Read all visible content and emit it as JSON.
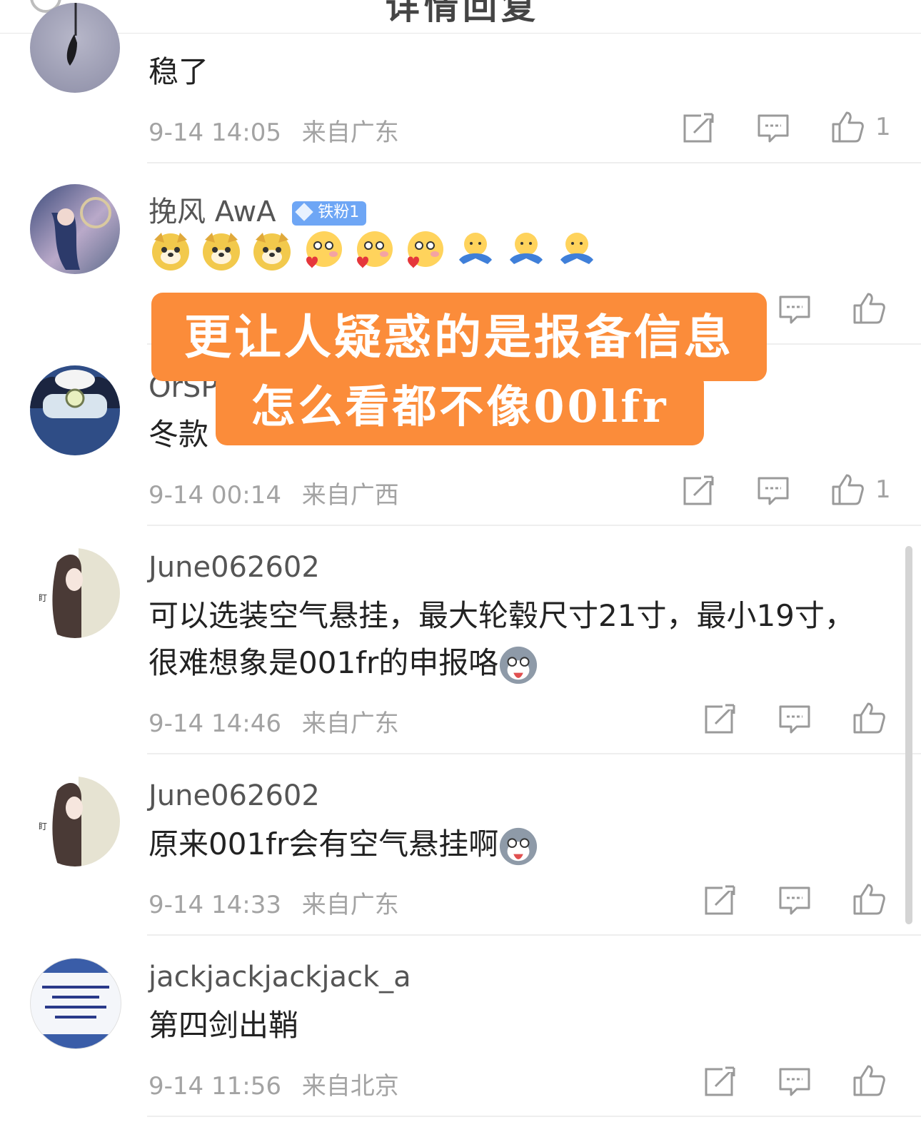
{
  "header": {
    "title": "详情回复",
    "more_icon": "more-icon"
  },
  "comments": [
    {
      "name": "",
      "text": "稳了",
      "date": "9-14 14:05",
      "location": "来自广东",
      "likes": "1"
    },
    {
      "name": "挽风 AwA",
      "badge": "铁粉1",
      "emojis": [
        "doge",
        "doge",
        "doge",
        "blush-heart",
        "blush-heart",
        "blush-heart",
        "hug",
        "hug",
        "hug"
      ]
    },
    {
      "name": "OrSP",
      "text": "冬款",
      "date": "9-14 00:14",
      "location": "来自广西",
      "likes": "1"
    },
    {
      "name": "June062602",
      "text": "可以选装空气悬挂，最大轮毂尺寸21寸，最小19寸，很难想象是001fr的申报咯",
      "date": "9-14 14:46",
      "location": "来自广东",
      "likes": ""
    },
    {
      "name": "June062602",
      "text": "原来001fr会有空气悬挂啊",
      "date": "9-14 14:33",
      "location": "来自广东",
      "likes": ""
    },
    {
      "name": "jackjackjackjack_a",
      "text": "第四剑出鞘",
      "date": "9-14 11:56",
      "location": "来自北京",
      "likes": ""
    }
  ],
  "overlay": {
    "line1": "更让人疑惑的是报备信息",
    "line2": "怎么看都不像00lfr",
    "color": "#fb8c3a"
  }
}
